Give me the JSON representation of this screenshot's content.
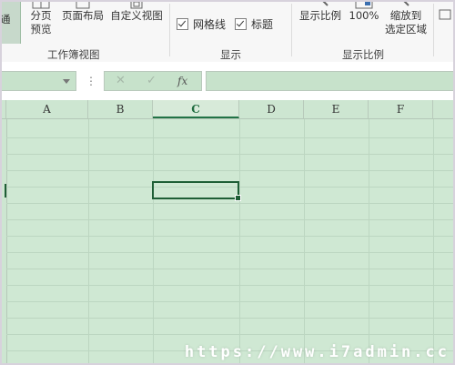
{
  "ribbon": {
    "workbook_views": {
      "normal_label": "通",
      "page_break_label": "分页\n预览",
      "page_layout_label": "页面布局",
      "custom_views_label": "自定义视图",
      "group_label": "工作簿视图"
    },
    "show": {
      "gridlines_label": "网格线",
      "headings_label": "标题",
      "group_label": "显示"
    },
    "zoom": {
      "zoom_label": "显示比例",
      "zoom100_label": "100%",
      "zoom_selection_label": "缩放到\n选定区域",
      "group_label": "显示比例"
    }
  },
  "formula_bar": {
    "dots": "⋮",
    "cancel": "✕",
    "enter": "✓",
    "fx": "fx"
  },
  "sheet": {
    "columns": [
      "A",
      "B",
      "C",
      "D",
      "E",
      "F"
    ],
    "selected_column": "C"
  },
  "watermark": "https://www.i7admin.cc",
  "colors": {
    "accent": "#217346",
    "cell_bg": "#cfe8d3"
  }
}
